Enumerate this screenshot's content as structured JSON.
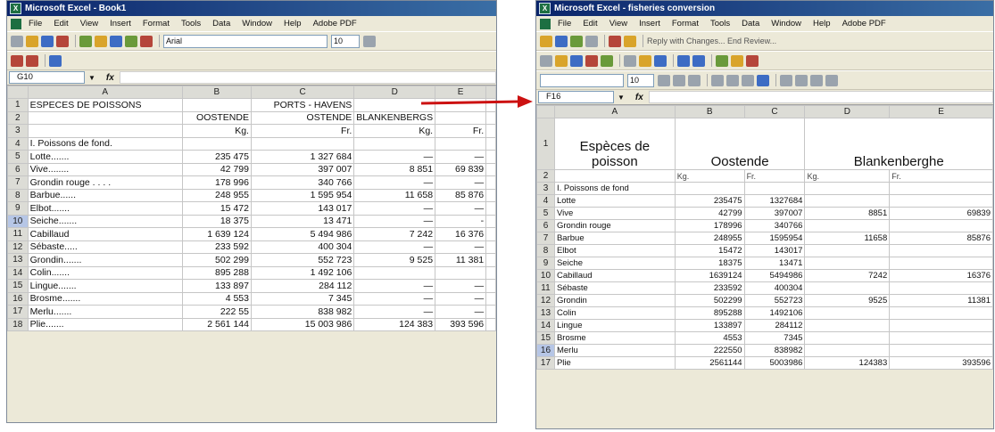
{
  "left": {
    "title": "Microsoft Excel - Book1",
    "menu": [
      "File",
      "Edit",
      "View",
      "Insert",
      "Format",
      "Tools",
      "Data",
      "Window",
      "Help",
      "Adobe PDF"
    ],
    "font_name": "Arial",
    "font_size": "10",
    "name_box": "G10",
    "fx": "fx",
    "columns": [
      "A",
      "B",
      "C",
      "D",
      "E"
    ],
    "rows": [
      {
        "n": "1",
        "a": "ESPECES DE POISSONS",
        "b": "",
        "c": "PORTS - HAVENS",
        "d": "",
        "e": ""
      },
      {
        "n": "2",
        "a": "",
        "b": "OOSTENDE",
        "c": "OSTENDE",
        "d": "BLANKENBERGS",
        "e": ""
      },
      {
        "n": "3",
        "a": "",
        "b": "Kg.",
        "c": "Fr.",
        "d": "Kg.",
        "e": "Fr."
      },
      {
        "n": "4",
        "a": "I. Poissons de fond.",
        "b": "",
        "c": "",
        "d": "",
        "e": ""
      },
      {
        "n": "5",
        "a": "Lotte.......",
        "b": "235 475",
        "c": "1 327 684",
        "d": "—",
        "e": "—"
      },
      {
        "n": "6",
        "a": "Vive........",
        "b": "42 799",
        "c": "397 007",
        "d": "8 851",
        "e": "69 839"
      },
      {
        "n": "7",
        "a": "Grondin rouge . . . .",
        "b": "178 996",
        "c": "340 766",
        "d": "—",
        "e": "—"
      },
      {
        "n": "8",
        "a": "Barbue......",
        "b": "248 955",
        "c": "1 595 954",
        "d": "11 658",
        "e": "85 876"
      },
      {
        "n": "9",
        "a": "Elbot.......",
        "b": "15 472",
        "c": "143 017",
        "d": "—",
        "e": "—"
      },
      {
        "n": "10",
        "a": "Seiche.......",
        "b": "18 375",
        "c": "13 471",
        "d": "—",
        "e": "-"
      },
      {
        "n": "11",
        "a": "Cabillaud",
        "b": "1 639 124",
        "c": "5 494 986",
        "d": "7 242",
        "e": "16 376"
      },
      {
        "n": "12",
        "a": "Sébaste.....",
        "b": "233 592",
        "c": "400 304",
        "d": "—",
        "e": "—"
      },
      {
        "n": "13",
        "a": "Grondin.......",
        "b": "502 299",
        "c": "552 723",
        "d": "9 525",
        "e": "11 381"
      },
      {
        "n": "14",
        "a": "Colin.......",
        "b": "895 288",
        "c": "1 492 106",
        "d": "",
        "e": ""
      },
      {
        "n": "15",
        "a": "Lingue.......",
        "b": "133 897",
        "c": "284 112",
        "d": "—",
        "e": "—"
      },
      {
        "n": "16",
        "a": "Brosme.......",
        "b": "4 553",
        "c": "7 345",
        "d": "—",
        "e": "—"
      },
      {
        "n": "17",
        "a": "Merlu.......",
        "b": "222 55",
        "c": "838 982",
        "d": "—",
        "e": "—"
      },
      {
        "n": "18",
        "a": "Plie.......",
        "b": "2 561 144",
        "c": "15 003 986",
        "d": "124 383",
        "e": "393 596"
      }
    ]
  },
  "right": {
    "title": "Microsoft Excel - fisheries conversion",
    "menu": [
      "File",
      "Edit",
      "View",
      "Insert",
      "Format",
      "Tools",
      "Data",
      "Window",
      "Help",
      "Adobe PDF"
    ],
    "review_text": "Reply with Changes... End Review...",
    "font_size": "10",
    "name_box": "F16",
    "fx": "fx",
    "columns": [
      "A",
      "B",
      "C",
      "D",
      "E"
    ],
    "header_row": {
      "n": "1",
      "a": "Espèces de poisson",
      "bc": "Oostende",
      "de": "Blankenberghe"
    },
    "unit_row": {
      "n": "2",
      "b": "Kg.",
      "c": "Fr.",
      "d": "Kg.",
      "e": "Fr."
    },
    "rows": [
      {
        "n": "3",
        "a": "I. Poissons de fond",
        "b": "",
        "c": "",
        "d": "",
        "e": ""
      },
      {
        "n": "4",
        "a": "Lotte",
        "b": "235475",
        "c": "1327684",
        "d": "",
        "e": ""
      },
      {
        "n": "5",
        "a": "Vive",
        "b": "42799",
        "c": "397007",
        "d": "8851",
        "e": "69839"
      },
      {
        "n": "6",
        "a": "Grondin rouge",
        "b": "178996",
        "c": "340766",
        "d": "",
        "e": ""
      },
      {
        "n": "7",
        "a": "Barbue",
        "b": "248955",
        "c": "1595954",
        "d": "11658",
        "e": "85876"
      },
      {
        "n": "8",
        "a": "Elbot",
        "b": "15472",
        "c": "143017",
        "d": "",
        "e": ""
      },
      {
        "n": "9",
        "a": "Seiche",
        "b": "18375",
        "c": "13471",
        "d": "",
        "e": ""
      },
      {
        "n": "10",
        "a": "Cabillaud",
        "b": "1639124",
        "c": "5494986",
        "d": "7242",
        "e": "16376"
      },
      {
        "n": "11",
        "a": "Sébaste",
        "b": "233592",
        "c": "400304",
        "d": "",
        "e": ""
      },
      {
        "n": "12",
        "a": "Grondin",
        "b": "502299",
        "c": "552723",
        "d": "9525",
        "e": "11381"
      },
      {
        "n": "13",
        "a": "Colin",
        "b": "895288",
        "c": "1492106",
        "d": "",
        "e": ""
      },
      {
        "n": "14",
        "a": "Lingue",
        "b": "133897",
        "c": "284112",
        "d": "",
        "e": ""
      },
      {
        "n": "15",
        "a": "Brosme",
        "b": "4553",
        "c": "7345",
        "d": "",
        "e": ""
      },
      {
        "n": "16",
        "a": "Merlu",
        "b": "222550",
        "c": "838982",
        "d": "",
        "e": ""
      },
      {
        "n": "17",
        "a": "Plie",
        "b": "2561144",
        "c": "5003986",
        "d": "124383",
        "e": "393596"
      }
    ]
  },
  "colors": {
    "arrow": "#cc1111",
    "title_bar": "#0a246a",
    "selected_header": "#b6c6e6"
  }
}
